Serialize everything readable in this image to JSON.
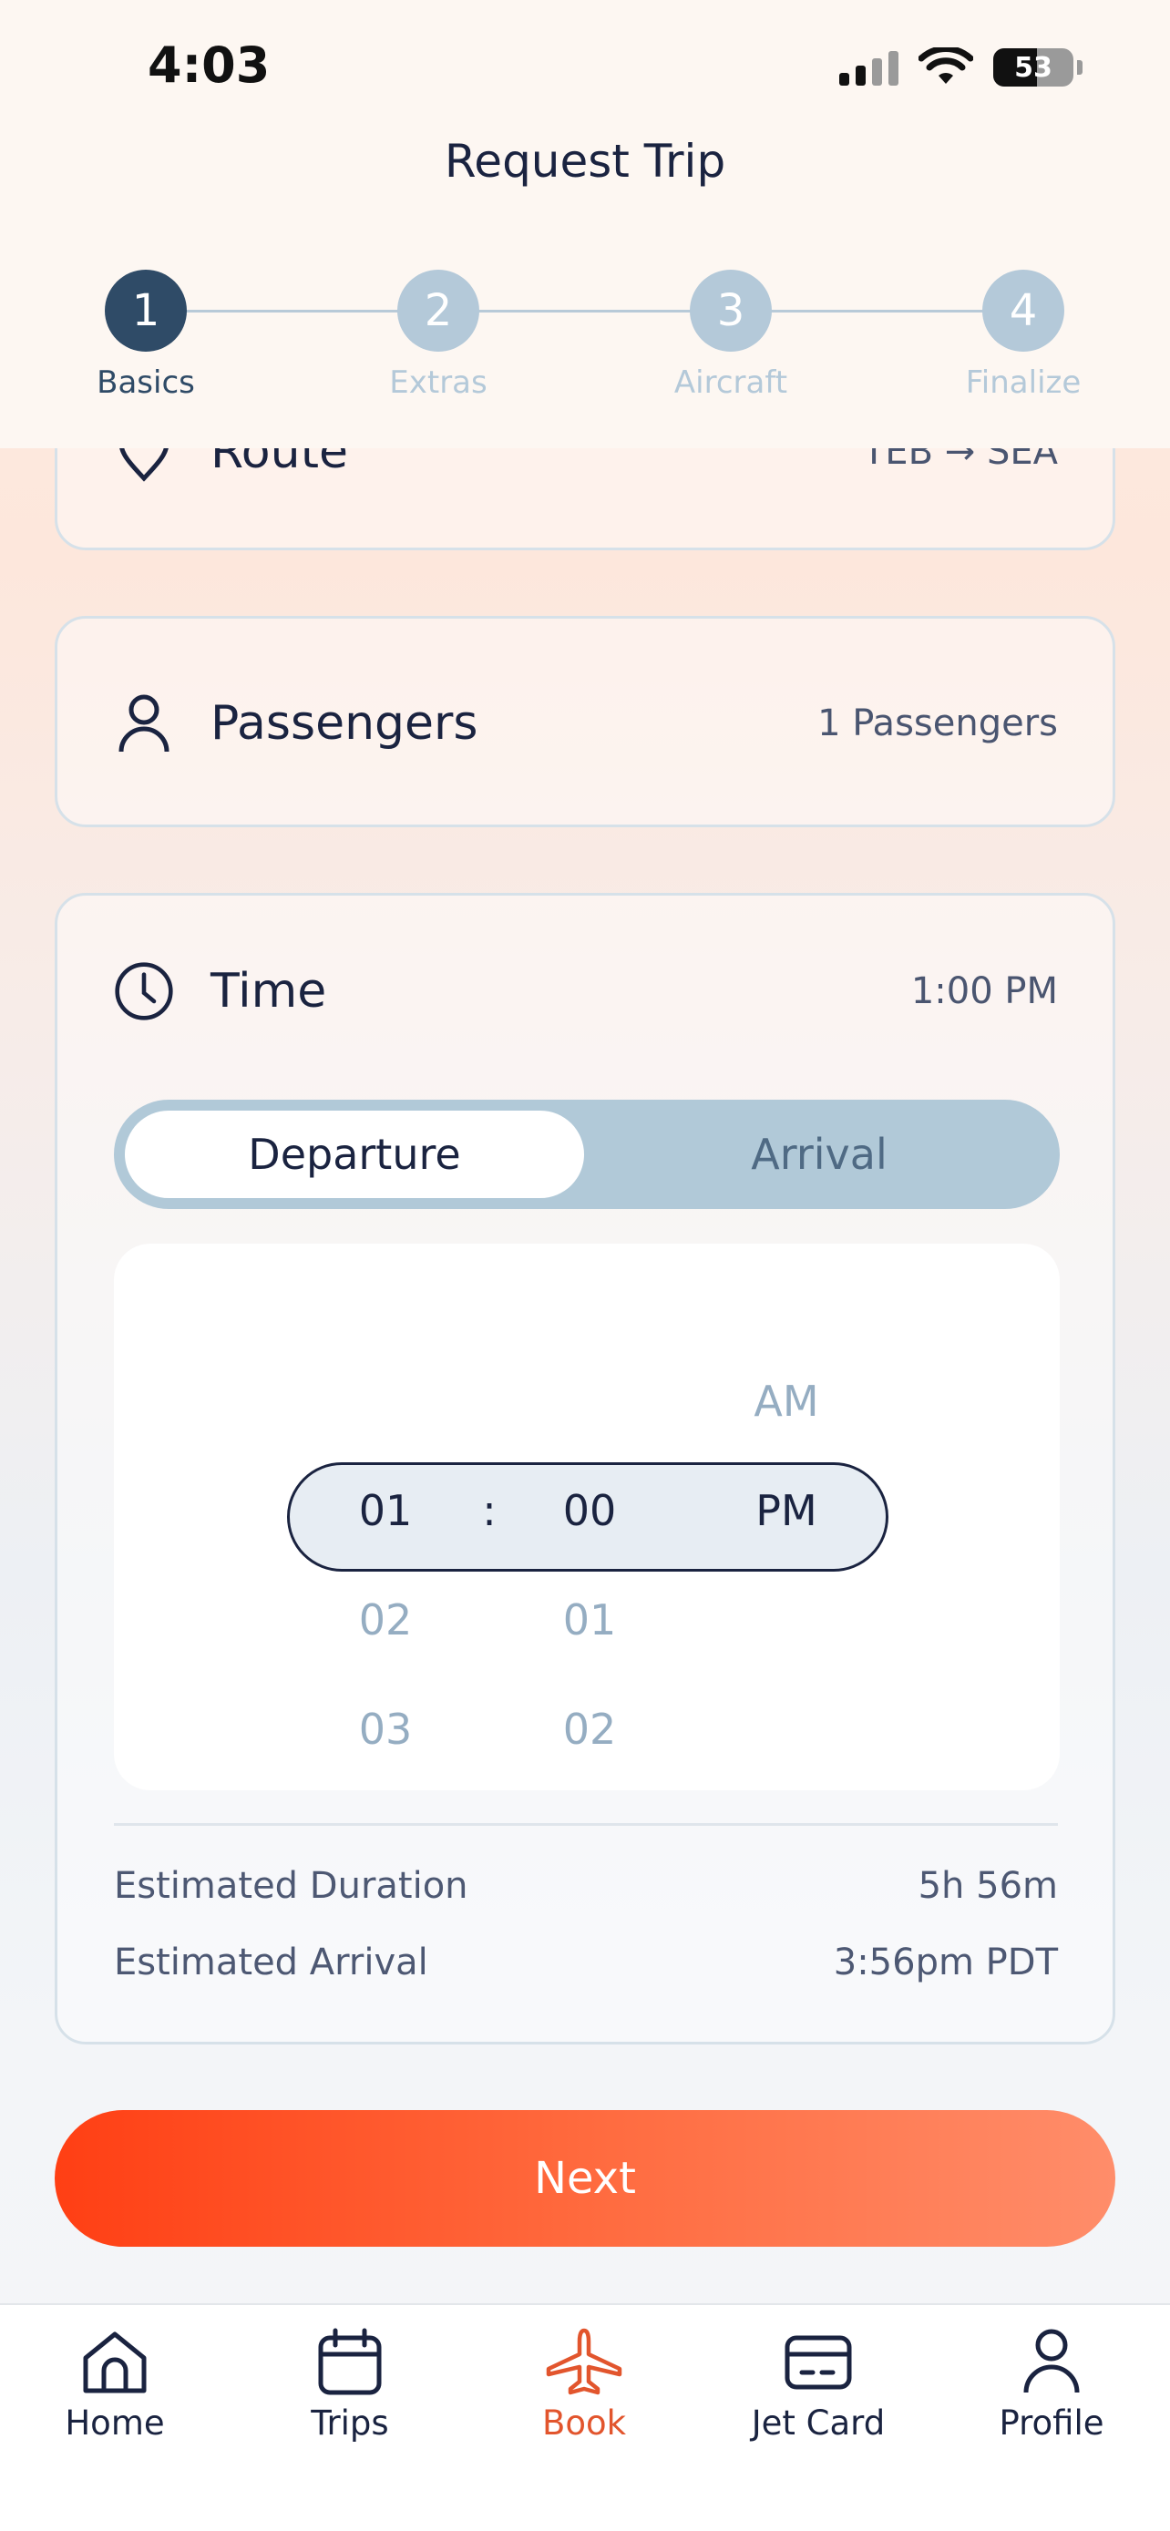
{
  "status_bar": {
    "time": "4:03",
    "battery": "53"
  },
  "header": {
    "title": "Request Trip"
  },
  "stepper": [
    {
      "number": "1",
      "label": "Basics",
      "active": true
    },
    {
      "number": "2",
      "label": "Extras",
      "active": false
    },
    {
      "number": "3",
      "label": "Aircraft",
      "active": false
    },
    {
      "number": "4",
      "label": "Finalize",
      "active": false
    }
  ],
  "route_card": {
    "title": "Route",
    "value": "TEB → SEA",
    "icon": "location-pin-icon"
  },
  "passengers_card": {
    "title": "Passengers",
    "value": "1 Passengers",
    "icon": "person-icon"
  },
  "time_card": {
    "title": "Time",
    "value": "1:00 PM",
    "icon": "clock-icon",
    "toggle": {
      "departure": "Departure",
      "arrival": "Arrival",
      "selected": "Departure"
    },
    "picker": {
      "separator": ":",
      "hour": {
        "selected": "01",
        "below": [
          "02",
          "03"
        ]
      },
      "minute": {
        "selected": "00",
        "below": [
          "01",
          "02"
        ]
      },
      "period": {
        "above": "AM",
        "selected": "PM"
      }
    },
    "estimated_duration_label": "Estimated Duration",
    "estimated_duration_value": "5h 56m",
    "estimated_arrival_label": "Estimated Arrival",
    "estimated_arrival_value": "3:56pm PDT"
  },
  "next_button": "Next",
  "tab_bar": [
    {
      "label": "Home",
      "icon": "home-icon",
      "active": false
    },
    {
      "label": "Trips",
      "icon": "calendar-icon",
      "active": false
    },
    {
      "label": "Book",
      "icon": "airplane-icon",
      "active": true
    },
    {
      "label": "Jet Card",
      "icon": "card-icon",
      "active": false
    },
    {
      "label": "Profile",
      "icon": "person-icon",
      "active": false
    }
  ],
  "colors": {
    "accent": "#ff4a1c",
    "navy": "#1a2340",
    "step_active": "#2f4b67",
    "step_inactive": "#b4c9d9"
  }
}
